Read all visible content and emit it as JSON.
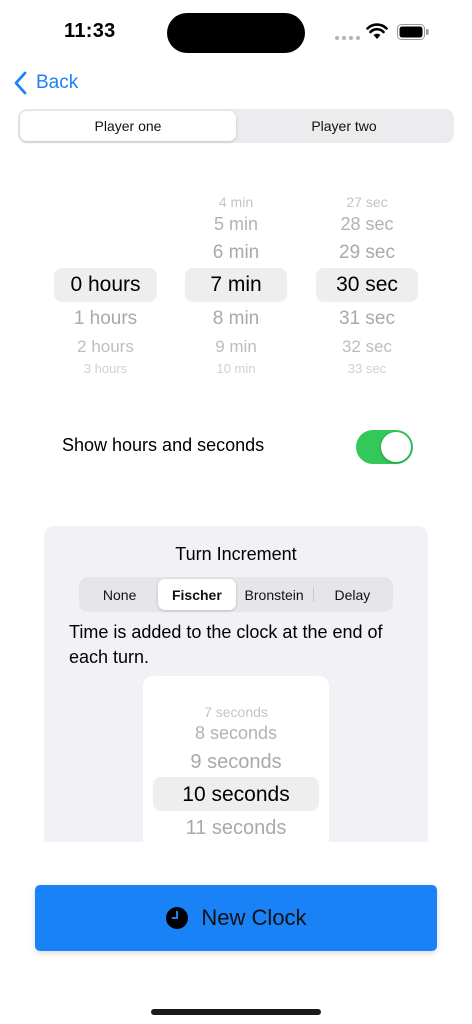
{
  "status": {
    "time": "11:33"
  },
  "nav": {
    "back_label": "Back"
  },
  "players": {
    "tabs": [
      "Player one",
      "Player two"
    ],
    "selected": 0
  },
  "time_picker": {
    "hours": [
      "",
      "",
      "0 hours",
      "1 hours",
      "2 hours",
      "3 hours"
    ],
    "minutes": [
      "4 min",
      "5 min",
      "6 min",
      "7 min",
      "8 min",
      "9 min",
      "10 min"
    ],
    "seconds": [
      "27 sec",
      "28 sec",
      "29 sec",
      "30 sec",
      "31 sec",
      "32 sec",
      "33 sec"
    ],
    "selected_hours": "0 hours",
    "selected_minutes": "7 min",
    "selected_seconds": "30 sec"
  },
  "settings": {
    "show_hours_seconds_label": "Show hours and seconds",
    "show_hours_seconds_on": true
  },
  "increment": {
    "title": "Turn Increment",
    "modes": [
      "None",
      "Fischer",
      "Bronstein",
      "Delay"
    ],
    "selected_mode": "Fischer",
    "description": "Time is added to the clock at the end of each turn.",
    "options": [
      "7 seconds",
      "8 seconds",
      "9 seconds",
      "10 seconds",
      "11 seconds"
    ],
    "selected_option": "10 seconds"
  },
  "actions": {
    "new_clock_label": "New Clock"
  },
  "colors": {
    "accent": "#1a82f7",
    "toggle_on": "#34c759"
  }
}
